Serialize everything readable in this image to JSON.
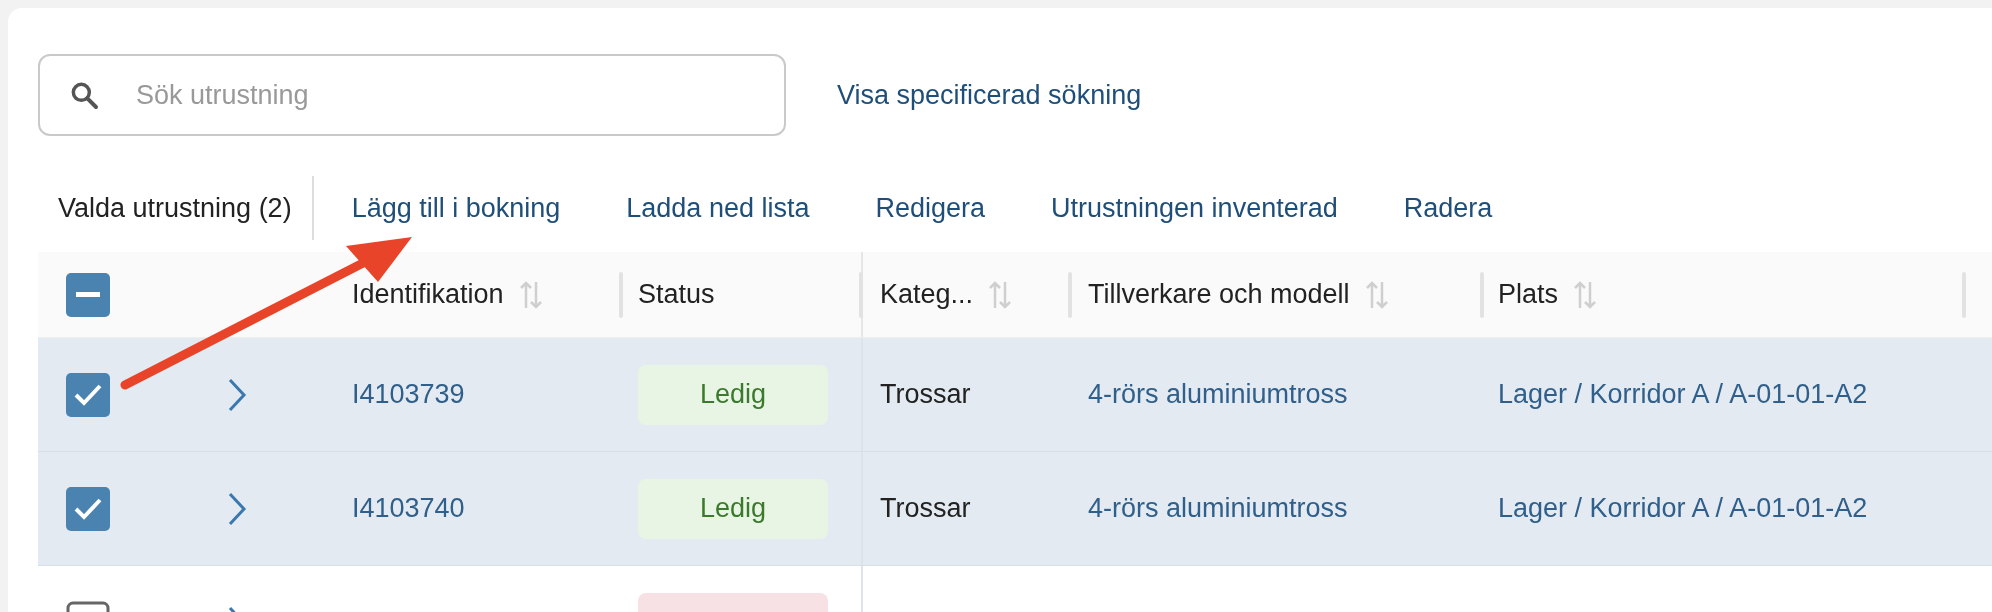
{
  "search": {
    "placeholder": "Sök utrustning"
  },
  "advanced_search_link": "Visa specificerad sökning",
  "selection_bar": {
    "label": "Valda utrustning (2)",
    "actions": [
      "Lägg till i bokning",
      "Ladda ned lista",
      "Redigera",
      "Utrustningen inventerad",
      "Radera"
    ]
  },
  "table": {
    "select_all": {
      "indeterminate": true
    },
    "columns": [
      {
        "label": "Identifikation",
        "sortable": true
      },
      {
        "label": "Status",
        "sortable": false
      },
      {
        "label": "Kateg...",
        "sortable": true
      },
      {
        "label": "Tillverkare och modell",
        "sortable": true
      },
      {
        "label": "Plats",
        "sortable": true
      }
    ],
    "rows": [
      {
        "checked": true,
        "id": "I4103739",
        "status": {
          "label": "Ledig",
          "kind": "available"
        },
        "category": "Trossar",
        "model": "4-rörs aluminiumtross",
        "location": "Lager / Korridor A / A-01-01-A2"
      },
      {
        "checked": true,
        "id": "I4103740",
        "status": {
          "label": "Ledig",
          "kind": "available"
        },
        "category": "Trossar",
        "model": "4-rörs aluminiumtross",
        "location": "Lager / Korridor A / A-01-01-A2"
      },
      {
        "checked": false,
        "status": {
          "kind": "unavailable"
        }
      }
    ]
  }
}
